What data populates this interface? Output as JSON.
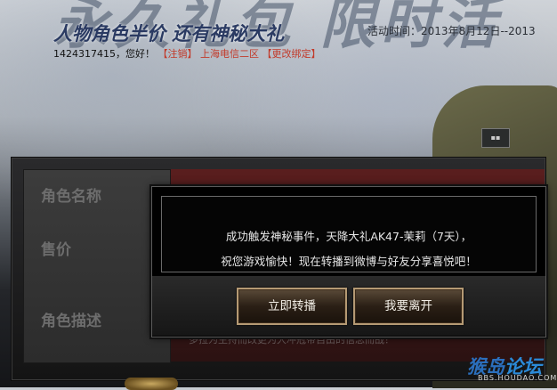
{
  "banner": {
    "big_title": "永久礼包 限时活",
    "subtitle": "人物角色半价 还有神秘大礼",
    "activity_time": "活动时间：2013年8月12日--2013",
    "user_id": "1424317415，您好！",
    "logout_link": "【注销】",
    "server": "上海电信二区",
    "change_binding": "【更改绑定】"
  },
  "panel": {
    "labels": [
      "角色名称",
      "售价",
      "角色描述"
    ],
    "description_partial": "多拉为主持而改更为大冲冠带自由的信念而战！"
  },
  "dialog": {
    "message_line1": "成功触发神秘事件，天降大礼AK47-茉莉（7天），",
    "message_line2": "祝您游戏愉快！现在转播到微博与好友分享喜悦吧！",
    "relay_button": "立即转播",
    "leave_button": "我要离开"
  },
  "watermark": {
    "logo_part1": "猴岛",
    "logo_part2": "论坛",
    "domain": "BBS.HOUDAO.COM"
  },
  "colors": {
    "accent_red": "#c23a2a",
    "button_border": "#b59a74",
    "subtitle_blue": "#2a3a62"
  }
}
